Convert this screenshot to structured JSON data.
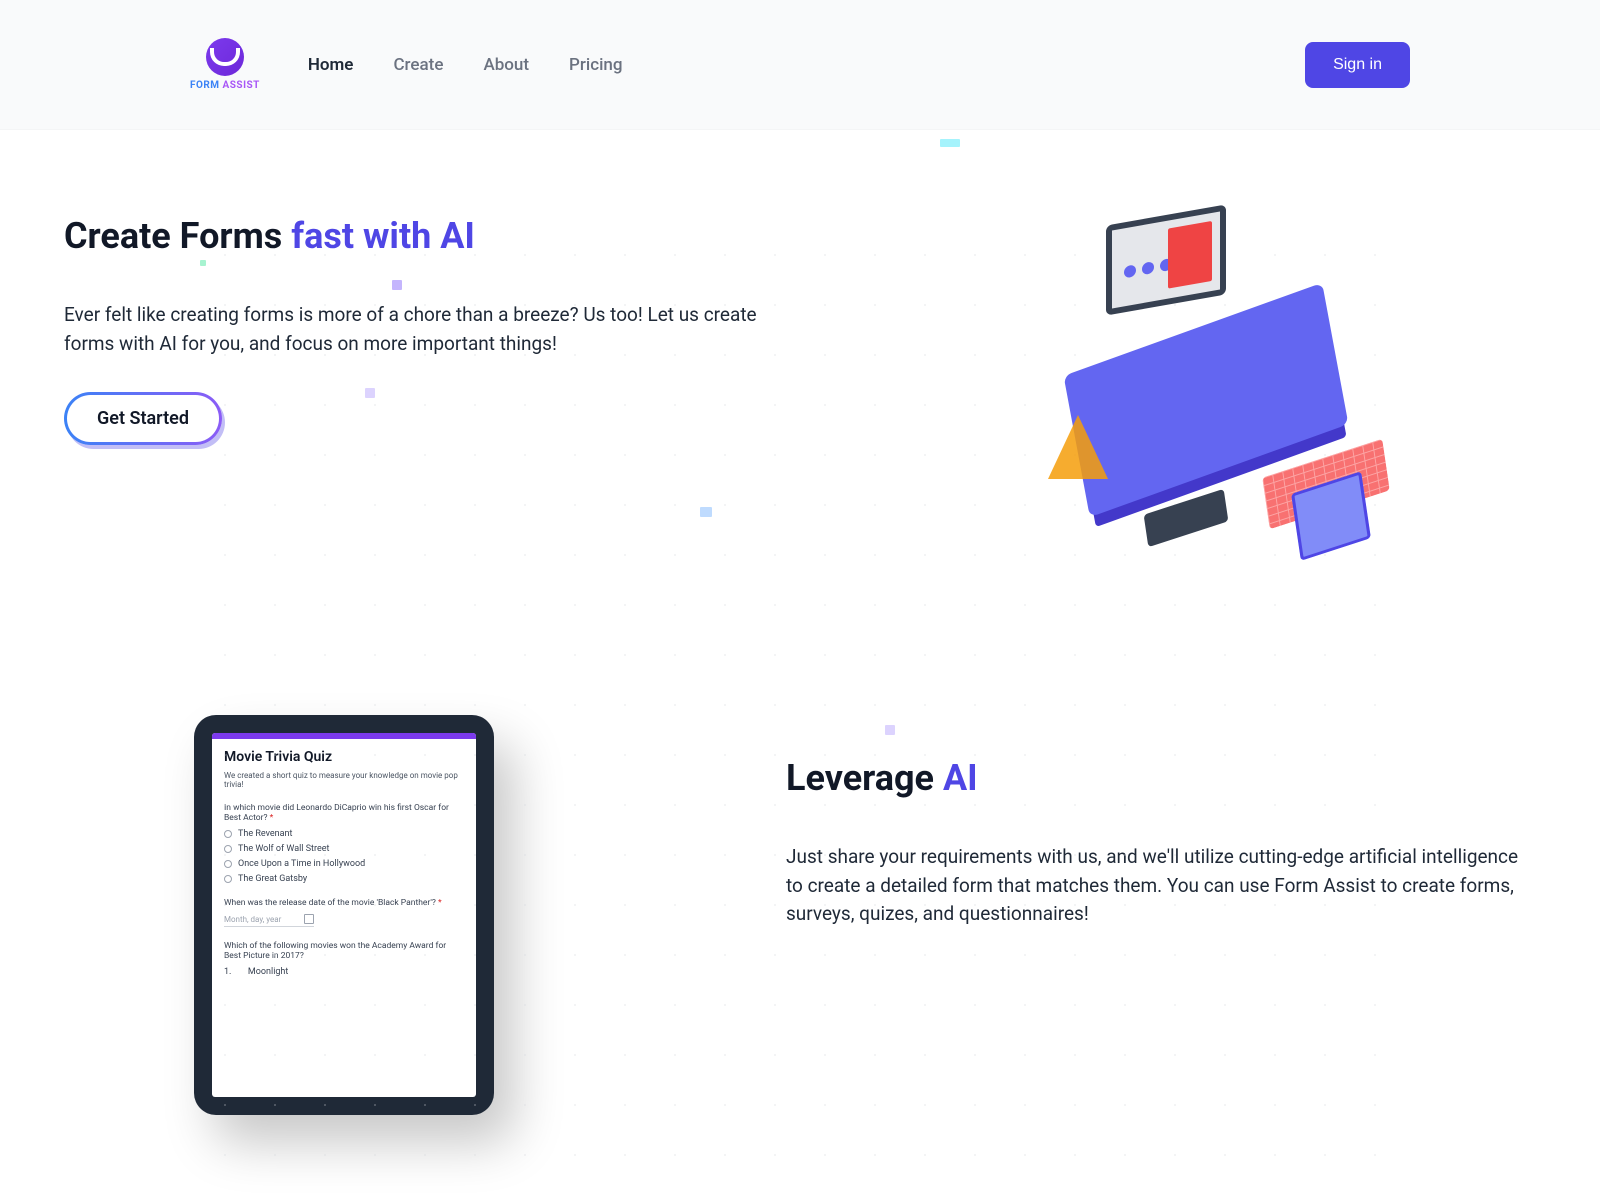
{
  "brand": {
    "name_a": "FORM",
    "name_b": "ASSIST"
  },
  "nav": {
    "items": [
      {
        "label": "Home",
        "active": true
      },
      {
        "label": "Create",
        "active": false
      },
      {
        "label": "About",
        "active": false
      },
      {
        "label": "Pricing",
        "active": false
      }
    ]
  },
  "header": {
    "signin": "Sign in"
  },
  "hero": {
    "title_plain": "Create Forms ",
    "title_accent": "fast with AI",
    "body": "Ever felt like creating forms is more of a chore than a breeze? Us too! Let us create forms with AI for you, and focus on more important things!",
    "cta": "Get Started"
  },
  "section2": {
    "title_plain": "Leverage ",
    "title_accent": "AI",
    "body": "Just share your requirements with us, and we'll utilize cutting-edge artificial intelligence to create a detailed form that matches them. You can use Form Assist to create forms, surveys, quizes, and questionnaires!"
  },
  "tablet": {
    "title": "Movie Trivia Quiz",
    "subtitle": "We created a short quiz to measure your knowledge on movie pop trivia!",
    "q1": {
      "text": "In which movie did Leonardo DiCaprio win his first Oscar for Best Actor? ",
      "required": "*",
      "options": [
        "The Revenant",
        "The Wolf of Wall Street",
        "Once Upon a Time in Hollywood",
        "The Great Gatsby"
      ]
    },
    "q2": {
      "text": "When was the release date of the movie 'Black Panther'? ",
      "required": "*",
      "placeholder": "Month, day, year"
    },
    "q3": {
      "text": "Which of the following movies won the Academy Award for Best Picture in 2017?",
      "first_option_num": "1.",
      "first_option": "Moonlight"
    }
  },
  "colors": {
    "accent": "#4f46e5"
  }
}
